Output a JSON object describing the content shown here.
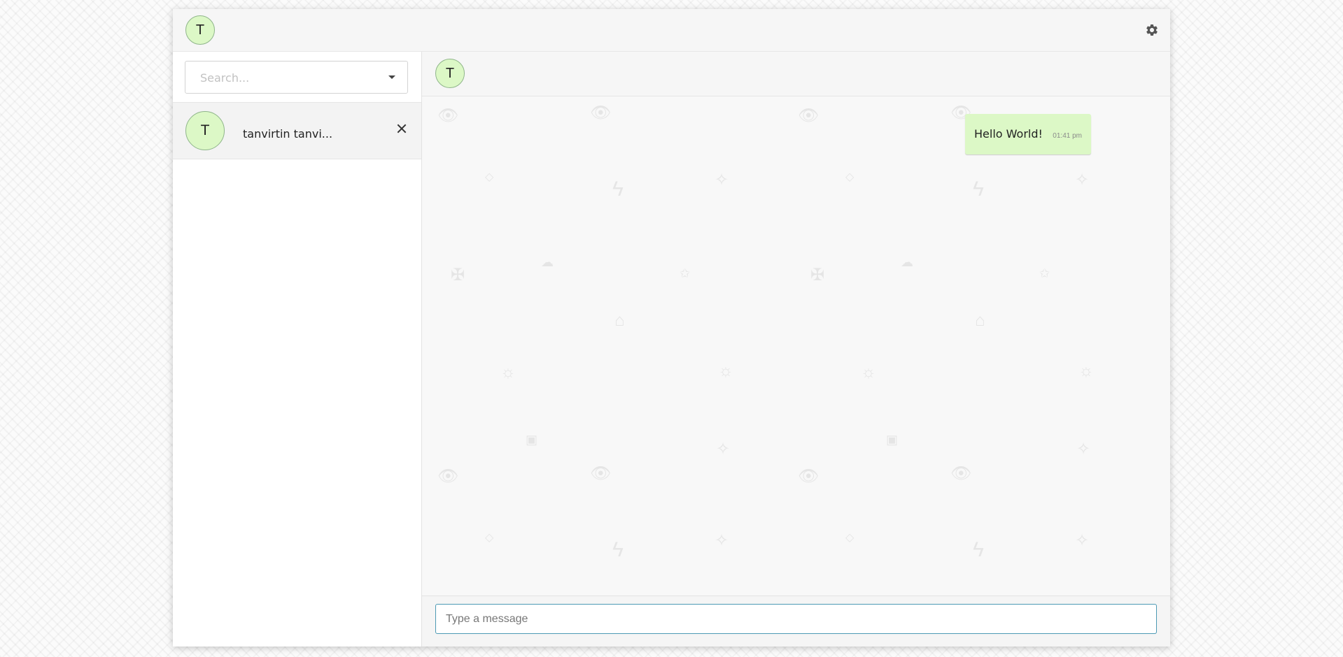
{
  "profile": {
    "avatar_initial": "T"
  },
  "toolbar": {
    "settings_icon": "gear-icon"
  },
  "sidebar": {
    "search": {
      "placeholder": "Search...",
      "value": ""
    },
    "contacts": [
      {
        "avatar_initial": "T",
        "name": "tanvirtin tanvi..."
      }
    ]
  },
  "chat": {
    "header": {
      "avatar_initial": "T"
    },
    "messages": [
      {
        "text": "Hello World!",
        "time": "01:41 pm",
        "outgoing": true
      }
    ],
    "composer": {
      "placeholder": "Type a message",
      "value": ""
    }
  },
  "colors": {
    "avatar_bg": "#dcf8c6",
    "bubble_outgoing": "#dcf8c6",
    "composer_border": "#4d9ab4"
  }
}
